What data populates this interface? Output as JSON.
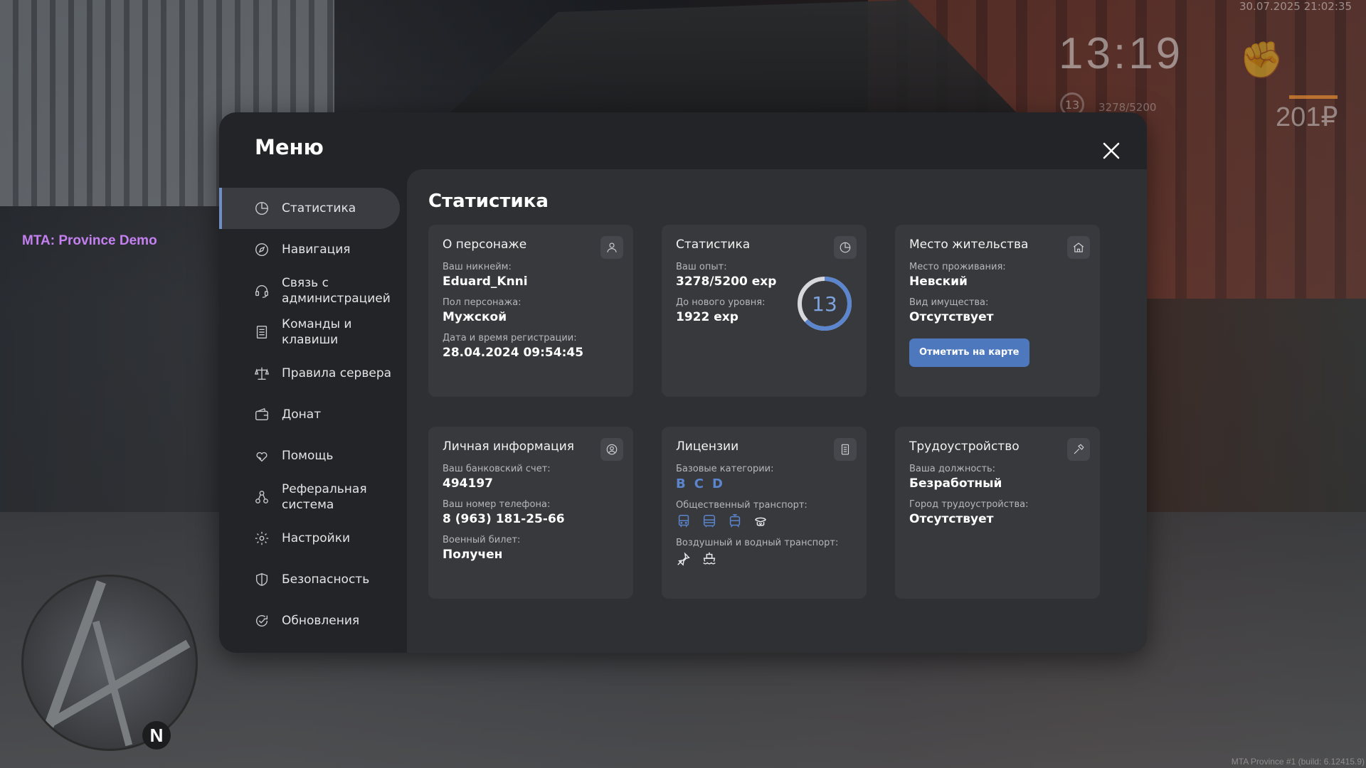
{
  "hud": {
    "datetime": "30.07.2025 21:02:35",
    "clock": "13:19",
    "level": "13",
    "exp": "3278/5200",
    "money": "201₽",
    "server_title": "MTA: Province Demo",
    "build_info": "MTA Province #1 (build: 6.12415.9)",
    "minimap_north": "N"
  },
  "modal": {
    "title": "Меню"
  },
  "sidebar": {
    "items": [
      {
        "label": "Статистика",
        "icon": "chart-pie-icon",
        "active": true
      },
      {
        "label": "Навигация",
        "icon": "compass-icon"
      },
      {
        "label": "Связь с администрацией",
        "icon": "headset-icon"
      },
      {
        "label": "Команды и клавиши",
        "icon": "document-list-icon"
      },
      {
        "label": "Правила сервера",
        "icon": "scales-icon"
      },
      {
        "label": "Донат",
        "icon": "wallet-icon"
      },
      {
        "label": "Помощь",
        "icon": "handshake-heart-icon"
      },
      {
        "label": "Реферальная система",
        "icon": "people-network-icon"
      },
      {
        "label": "Настройки",
        "icon": "gear-icon"
      },
      {
        "label": "Безопасность",
        "icon": "shield-icon"
      },
      {
        "label": "Обновления",
        "icon": "refresh-check-icon"
      }
    ]
  },
  "content": {
    "title": "Статистика",
    "character": {
      "title": "О персонаже",
      "icon": "user-icon",
      "nickname_label": "Ваш никнейм:",
      "nickname": "Eduard_Knni",
      "gender_label": "Пол персонажа:",
      "gender": "Мужской",
      "regdate_label": "Дата и время регистрации:",
      "regdate": "28.04.2024 09:54:45"
    },
    "stats": {
      "title": "Статистика",
      "icon": "chart-pie-icon",
      "exp_label": "Ваш опыт:",
      "exp": "3278/5200 exp",
      "next_label": "До нового уровня:",
      "next": "1922 exp",
      "level": "13",
      "progress": 0.63,
      "ring_color": "#5b85cc"
    },
    "residence": {
      "title": "Место жительства",
      "icon": "house-icon",
      "place_label": "Место проживания:",
      "place": "Невский",
      "property_label": "Вид имущества:",
      "property": "Отсутствует",
      "map_button": "Отметить на карте"
    },
    "personal": {
      "title": "Личная информация",
      "icon": "user-circle-icon",
      "bank_label": "Ваш банковский счет:",
      "bank": "494197",
      "phone_label": "Ваш номер телефона:",
      "phone": "8 (963) 181-25-66",
      "military_label": "Военный билет:",
      "military": "Получен"
    },
    "licenses": {
      "title": "Лицензии",
      "icon": "id-card-icon",
      "base_label": "Базовые категории:",
      "base": [
        "B",
        "C",
        "D"
      ],
      "public_label": "Общественный транспорт:",
      "public_icons": [
        "bus-icon",
        "bus-front-icon",
        "tram-icon",
        "taxi-cap-icon"
      ],
      "air_label": "Воздушный и водный транспорт:",
      "air_icons": [
        "airplane-icon",
        "ship-icon"
      ]
    },
    "employment": {
      "title": "Трудоустройство",
      "icon": "hammer-icon",
      "position_label": "Ваша должность:",
      "position": "Безработный",
      "city_label": "Город трудоустройства:",
      "city": "Отсутствует"
    }
  }
}
